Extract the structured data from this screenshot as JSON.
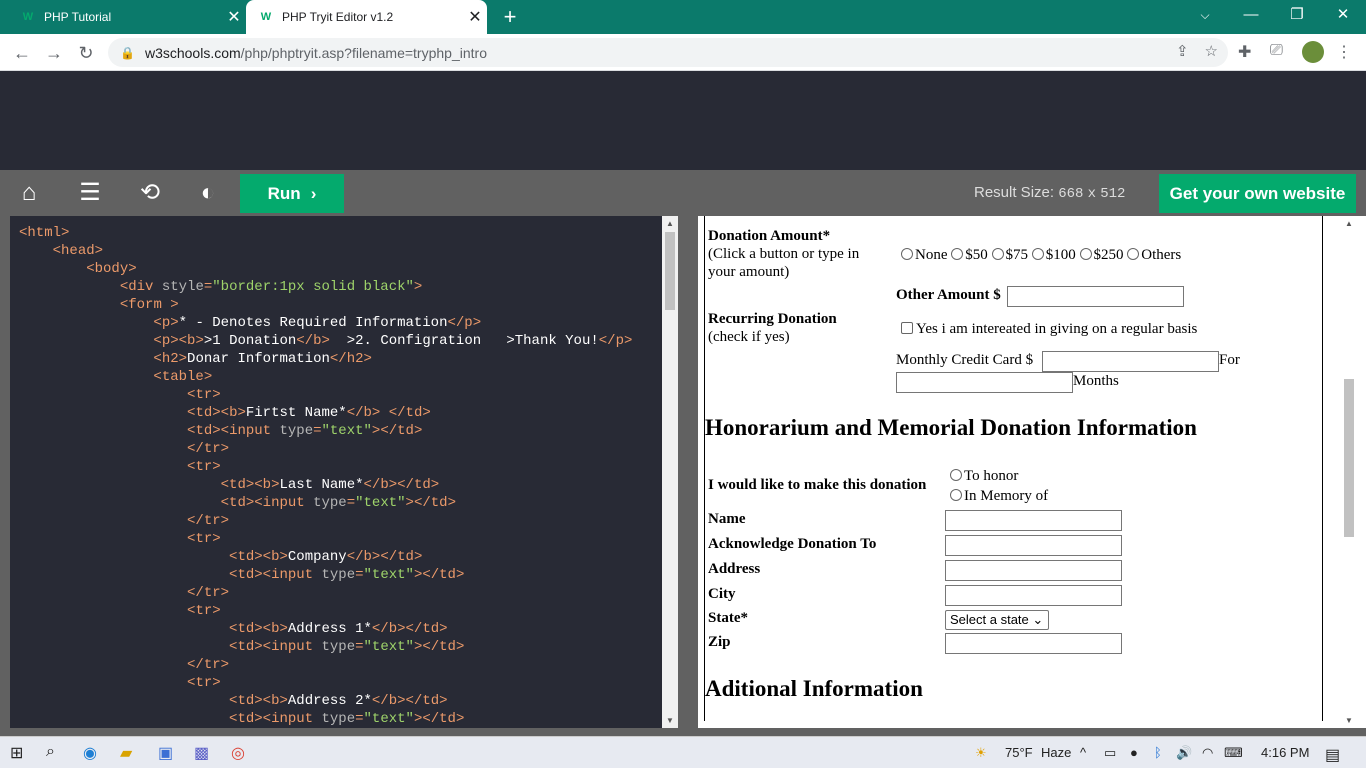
{
  "browser": {
    "tabs": [
      {
        "title": "PHP Tutorial",
        "favicon": "w3schools-icon",
        "active": false
      },
      {
        "title": "PHP Tryit Editor v1.2",
        "favicon": "w3schools-icon",
        "active": true
      }
    ],
    "url_host": "w3schools.com",
    "url_path": "/php/phptryit.asp?filename=tryphp_intro"
  },
  "toolbar": {
    "run_label": "Run",
    "result_size_label": "Result Size:",
    "result_width": "668",
    "result_x": "x",
    "result_height": "512",
    "get_website_label": "Get your own website"
  },
  "code_lines": [
    {
      "indent": 0,
      "html": "<html>"
    },
    {
      "indent": 1,
      "html": "<head>"
    },
    {
      "indent": 2,
      "html": "<body>"
    },
    {
      "indent": 3,
      "html": "<div style=\"border:1px solid black\">"
    },
    {
      "indent": 3,
      "html": "<form >"
    },
    {
      "indent": 4,
      "html": "<p>* - Denotes Required Information</p>"
    },
    {
      "indent": 4,
      "html": "<p><b>>1 Donation</b>  >2. Configration   >Thank You!</p>"
    },
    {
      "indent": 4,
      "html": "<h2>Donar Information</h2>"
    },
    {
      "indent": 4,
      "html": "<table>"
    },
    {
      "indent": 5,
      "html": "<tr>"
    },
    {
      "indent": 5,
      "html": "<td><b>Firtst Name*</b> </td>"
    },
    {
      "indent": 5,
      "html": "<td><input type=\"text\"></td>"
    },
    {
      "indent": 5,
      "html": "</tr>"
    },
    {
      "indent": 5,
      "html": "<tr>"
    },
    {
      "indent": 6,
      "html": "<td><b>Last Name*</b></td>"
    },
    {
      "indent": 6,
      "html": "<td><input type=\"text\"></td>"
    },
    {
      "indent": 5,
      "html": "</tr>"
    },
    {
      "indent": 5,
      "html": "<tr>"
    },
    {
      "indent": 6.3,
      "html": "<td><b>Company</b></td>"
    },
    {
      "indent": 6.3,
      "html": "<td><input type=\"text\"></td>"
    },
    {
      "indent": 5,
      "html": "</tr>"
    },
    {
      "indent": 5,
      "html": "<tr>"
    },
    {
      "indent": 6.3,
      "html": "<td><b>Address 1*</b></td>"
    },
    {
      "indent": 6.3,
      "html": "<td><input type=\"text\"></td>"
    },
    {
      "indent": 5,
      "html": "</tr>"
    },
    {
      "indent": 5,
      "html": "<tr>"
    },
    {
      "indent": 6.3,
      "html": "<td><b>Address 2*</b></td>"
    },
    {
      "indent": 6.3,
      "html": "<td><input type=\"text\"></td>"
    }
  ],
  "result": {
    "donation_amount_label": "Donation Amount*",
    "donation_amount_hint_1": "(Click a button or type in",
    "donation_amount_hint_2": "your amount)",
    "amount_options": [
      "None",
      "$50",
      "$75",
      "$100",
      "$250",
      "Others"
    ],
    "other_amount_label": "Other Amount $",
    "recurring_label": "Recurring Donation",
    "recurring_hint": "(check if yes)",
    "recurring_checkbox_label": "Yes i am intereated in giving on a regular basis",
    "monthly_label": "Monthly Credit Card $",
    "for_label": "For",
    "months_label": "Months",
    "honorarium_heading": "Honorarium and Memorial Donation Information",
    "make_donation_label": "I would like to make this donation",
    "honor_options": [
      "To honor",
      "In Memory of"
    ],
    "fields": [
      "Name",
      "Acknowledge Donation To",
      "Address",
      "City",
      "State*",
      "Zip"
    ],
    "state_placeholder": "Select a state",
    "additional_heading": "Aditional Information"
  },
  "taskbar": {
    "temperature": "75°F",
    "weather": "Haze",
    "time": "4:16 PM"
  },
  "colors": {
    "tab_strip": "#0b7a6b",
    "w3_green": "#04AA6D",
    "editor_bg": "#282a35",
    "toolbar_bg": "#616161"
  }
}
